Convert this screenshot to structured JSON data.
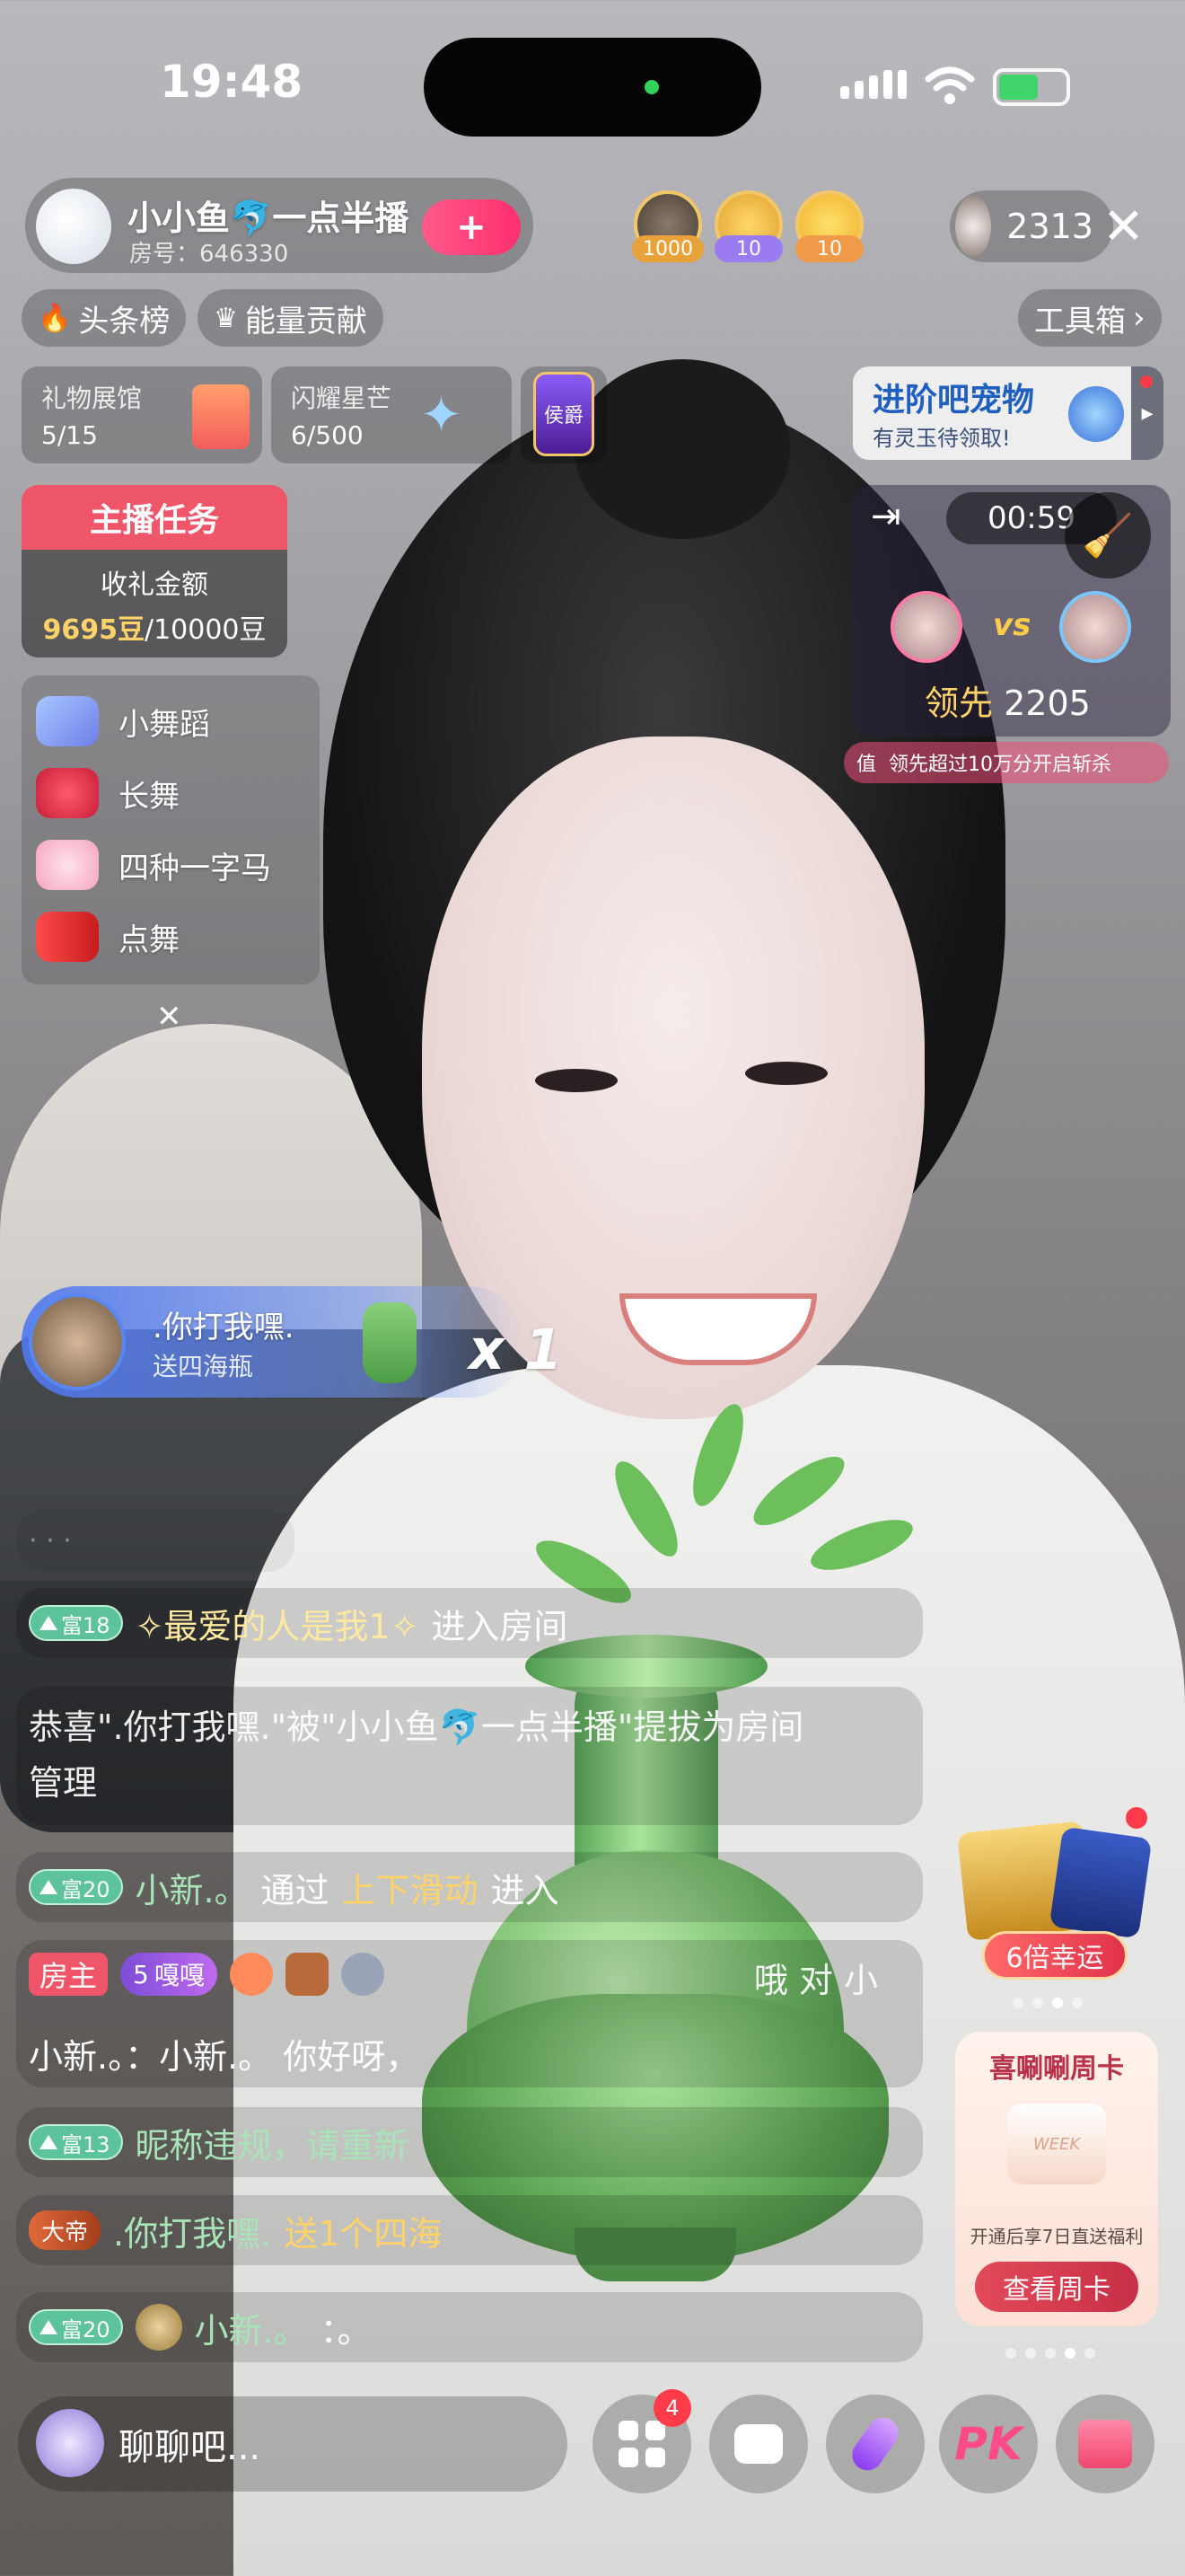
{
  "status_bar": {
    "time": "19:48"
  },
  "header": {
    "host_name": "小小鱼🐬一点半播",
    "room_label": "房号：646330",
    "follow_icon": "+",
    "viewers": [
      {
        "badge": "1000",
        "color": "#e8a23a"
      },
      {
        "badge": "10",
        "color": "#9b7cf0"
      },
      {
        "badge": "10",
        "color": "#ef9a48"
      }
    ],
    "online_count": "2313",
    "close_icon": "✕"
  },
  "chips": {
    "headlines": "头条榜",
    "energy": "能量贡献",
    "toolbox": "工具箱"
  },
  "cards": {
    "gift_hall": {
      "label": "礼物展馆",
      "value": "5/15"
    },
    "star": {
      "label": "闪耀星芒",
      "value": "6/500"
    },
    "badge_text": "侯爵",
    "pet": {
      "title": "进阶吧宠物",
      "subtitle": "有灵玉待领取!"
    }
  },
  "task": {
    "title": "主播任务",
    "label": "收礼金额",
    "progress": "9695豆",
    "goal": "/10000豆"
  },
  "song_list": [
    "小舞蹈",
    "长舞",
    "四种一字马",
    "点舞"
  ],
  "pk": {
    "timer": "00:59",
    "vs": "vs",
    "lead_label": "领先",
    "lead_value": "2205",
    "note_prefix": "值",
    "note": "领先超过10万分开启斩杀"
  },
  "gift_toast": {
    "user": ".你打我嘿.",
    "action": "送四海瓶",
    "multiplier": "x 1"
  },
  "chat": {
    "r1_name": "✧最爱的人是我1✧",
    "r1_level": "富18",
    "r1_text": "进入房间",
    "r2_text": "恭喜\".你打我嘿.\"被\"小小鱼🐬一点半播\"提拔为房间管理",
    "r3_level": "富20",
    "r3_name": "小新.。",
    "r3_pre": "通过",
    "r3_hl": "上下滑动",
    "r3_post": "进入",
    "r4_role": "房主",
    "r4_badge": "嘎嘎",
    "r4_badge_num": "5",
    "r4_text": "小新.。：小新.。 你好呀，",
    "r4_tail": "哦 对 小",
    "r5_level": "富13",
    "r5_text": "昵称违规，请重新",
    "r6_badge": "大帝",
    "r6_name": ".你打我嘿.",
    "r6_text": "送1个四海",
    "r7_level": "富20",
    "r7_name": "小新.。",
    "r7_text": "：。"
  },
  "side": {
    "luck": "6倍幸运",
    "week_title": "喜唰唰周卡",
    "week_tag": "WEEK",
    "week_desc": "开通后享7日直送福利",
    "week_btn": "查看周卡"
  },
  "bottom": {
    "placeholder": "聊聊吧...",
    "menu_badge": "4",
    "pk_label": "PK"
  }
}
